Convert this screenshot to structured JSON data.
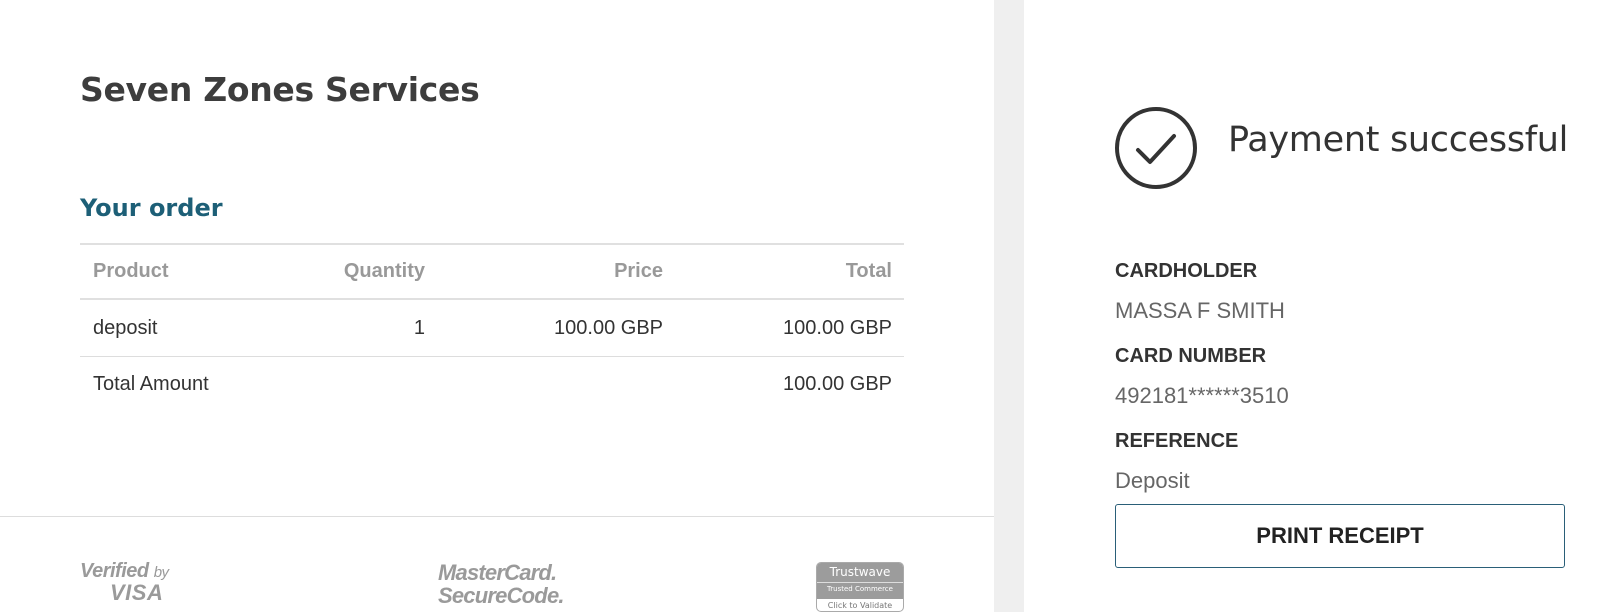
{
  "merchant": {
    "name": "Seven Zones Services"
  },
  "order": {
    "title": "Your order",
    "columns": [
      "Product",
      "Quantity",
      "Price",
      "Total"
    ],
    "items": [
      {
        "product": "deposit",
        "quantity": "1",
        "price": "100.00 GBP",
        "total": "100.00 GBP"
      }
    ],
    "total_label": "Total Amount",
    "total_value": "100.00 GBP"
  },
  "footer_logos": {
    "visa_line1": "Verified",
    "visa_by": "by",
    "visa_line2": "VISA",
    "mastercard_line1": "MasterCard.",
    "mastercard_line2": "SecureCode.",
    "trustwave_brand": "Trustwave",
    "trustwave_sub": "Trusted Commerce",
    "trustwave_action": "Click to Validate"
  },
  "payment": {
    "status": "Payment successful",
    "status_icon": "check-circle-icon",
    "cardholder_label": "CARDHOLDER",
    "cardholder_value": "MASSA F SMITH",
    "card_number_label": "CARD NUMBER",
    "card_number_value": "492181******3510",
    "reference_label": "REFERENCE",
    "reference_value": "Deposit",
    "print_button": "PRINT RECEIPT"
  },
  "colors": {
    "accent": "#1d5f77",
    "button_border": "#2a5f78",
    "divider": "#efefef"
  }
}
